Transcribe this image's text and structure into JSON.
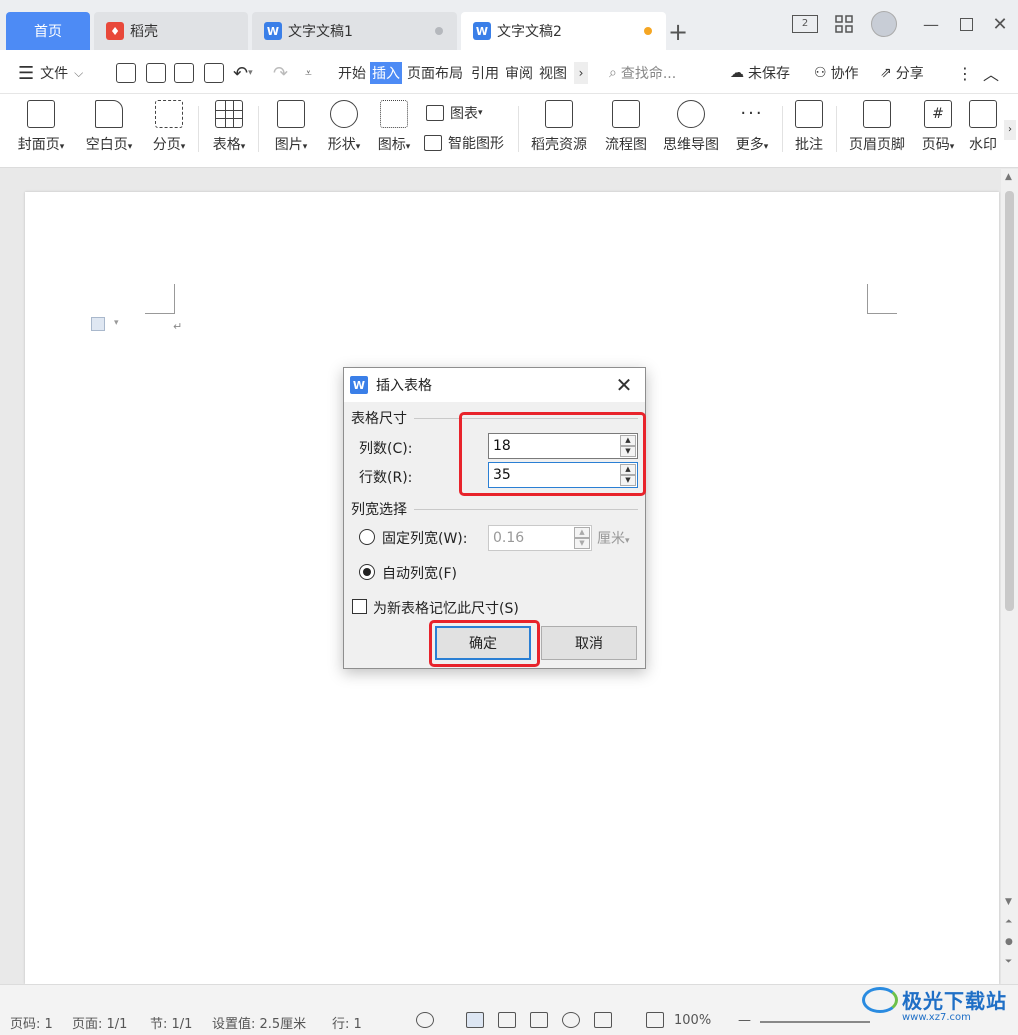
{
  "tabs": {
    "home": "首页",
    "docer": "稻壳",
    "doc1": "文字文稿1",
    "doc2": "文字文稿2"
  },
  "menu": {
    "file": "文件",
    "start": "开始",
    "insert": "插入",
    "layout": "页面布局",
    "reference": "引用",
    "review": "审阅",
    "view": "视图",
    "search": "查找命...",
    "unsaved": "未保存",
    "collab": "协作",
    "share": "分享"
  },
  "ribbon": {
    "cover": "封面页",
    "blank": "空白页",
    "pagebreak": "分页",
    "table": "表格",
    "picture": "图片",
    "shape": "形状",
    "icon": "图标",
    "chart": "图表",
    "smartart": "智能图形",
    "docer_res": "稻壳资源",
    "flowchart": "流程图",
    "mindmap": "思维导图",
    "more": "更多",
    "comment": "批注",
    "headerfooter": "页眉页脚",
    "pagenum": "页码",
    "watermark": "水印"
  },
  "dialog": {
    "title": "插入表格",
    "size_group": "表格尺寸",
    "cols_label": "列数(C):",
    "cols_value": "18",
    "rows_label": "行数(R):",
    "rows_value": "35",
    "width_group": "列宽选择",
    "fixed_label": "固定列宽(W):",
    "fixed_value": "0.16",
    "fixed_unit": "厘米",
    "auto_label": "自动列宽(F)",
    "remember_label": "为新表格记忆此尺寸(S)",
    "ok": "确定",
    "cancel": "取消"
  },
  "status": {
    "page": "页码: 1",
    "pages": "页面: 1/1",
    "section": "节: 1/1",
    "setting": "设置值: 2.5厘米",
    "row": "行: 1",
    "zoom": "100%"
  },
  "watermark_brand": {
    "text": "极光下载站",
    "url": "www.xz7.com"
  },
  "colors": {
    "accent": "#4d8bf5",
    "highlight_box": "#e8232b",
    "unsaved_dot": "#f5a623"
  }
}
